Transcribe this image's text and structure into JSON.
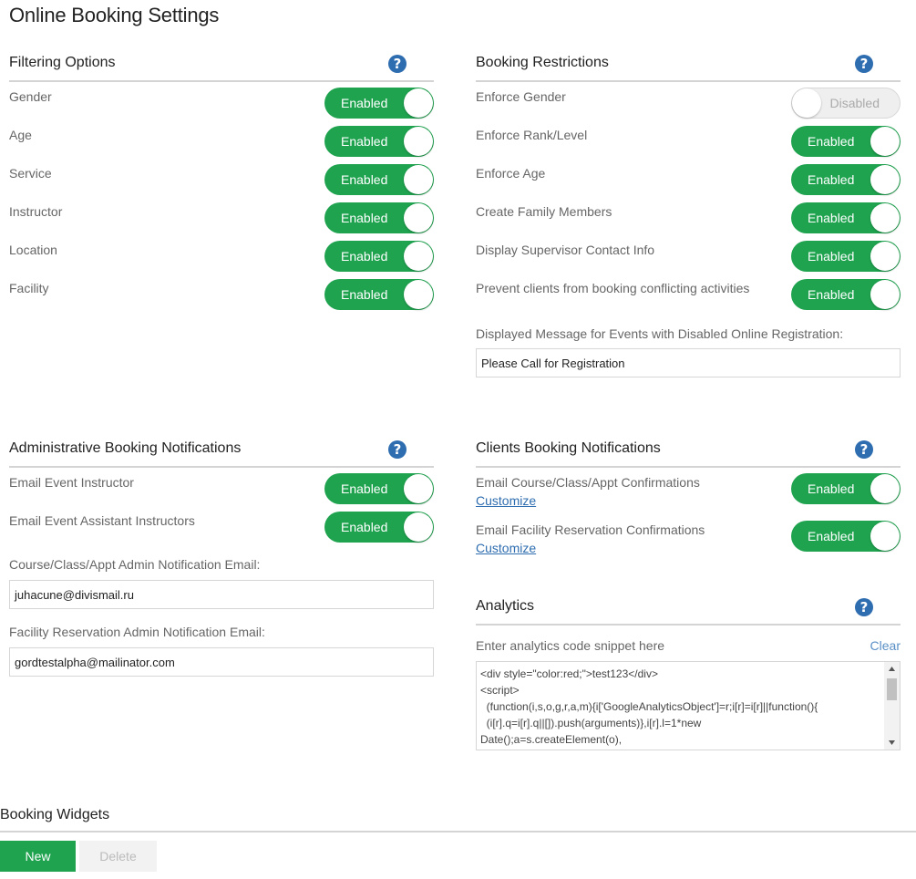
{
  "page": {
    "title": "Online Booking Settings"
  },
  "filtering": {
    "title": "Filtering Options",
    "rows": [
      {
        "label": "Gender",
        "state": "Enabled"
      },
      {
        "label": "Age",
        "state": "Enabled"
      },
      {
        "label": "Service",
        "state": "Enabled"
      },
      {
        "label": "Instructor",
        "state": "Enabled"
      },
      {
        "label": "Location",
        "state": "Enabled"
      },
      {
        "label": "Facility",
        "state": "Enabled"
      }
    ]
  },
  "restrictions": {
    "title": "Booking Restrictions",
    "rows": [
      {
        "label": "Enforce Gender",
        "state": "Disabled"
      },
      {
        "label": "Enforce Rank/Level",
        "state": "Enabled"
      },
      {
        "label": "Enforce Age",
        "state": "Enabled"
      },
      {
        "label": "Create Family Members",
        "state": "Enabled"
      },
      {
        "label": "Display Supervisor Contact Info",
        "state": "Enabled"
      },
      {
        "label": "Prevent clients from booking conflicting activities",
        "state": "Enabled"
      }
    ],
    "message_label": "Displayed Message for Events with Disabled Online Registration:",
    "message_value": "Please Call for Registration"
  },
  "admin_notifications": {
    "title": "Administrative Booking Notifications",
    "rows": [
      {
        "label": "Email Event Instructor",
        "state": "Enabled"
      },
      {
        "label": "Email Event Assistant Instructors",
        "state": "Enabled"
      }
    ],
    "course_email_label": "Course/Class/Appt Admin Notification Email:",
    "course_email_value": "juhacune@divismail.ru",
    "facility_email_label": "Facility Reservation Admin Notification Email:",
    "facility_email_value": "gordtestalpha@mailinator.com"
  },
  "client_notifications": {
    "title": "Clients Booking Notifications",
    "rows": [
      {
        "label": "Email Course/Class/Appt Confirmations",
        "link": "Customize",
        "state": "Enabled"
      },
      {
        "label": "Email Facility Reservation Confirmations",
        "link": "Customize",
        "state": "Enabled"
      }
    ]
  },
  "analytics": {
    "title": "Analytics",
    "prompt": "Enter analytics code snippet here",
    "clear_label": "Clear",
    "code_lines": [
      "<div style=\"color:red;\">test123</div>",
      "<script>",
      "  (function(i,s,o,g,r,a,m){i['GoogleAnalyticsObject']=r;i[r]=i[r]||function(){",
      "  (i[r].q=i[r].q||[]).push(arguments)},i[r].l=1*new",
      "Date();a=s.createElement(o),"
    ]
  },
  "widgets": {
    "title": "Booking Widgets",
    "new_label": "New",
    "delete_label": "Delete"
  },
  "colors": {
    "accent_green": "#1fa34f",
    "help_blue": "#2e6db0",
    "disabled_gray": "#efefef"
  },
  "icons": {
    "help": "question-circle-icon",
    "scroll_up": "arrow-up-icon",
    "scroll_down": "arrow-down-icon"
  }
}
